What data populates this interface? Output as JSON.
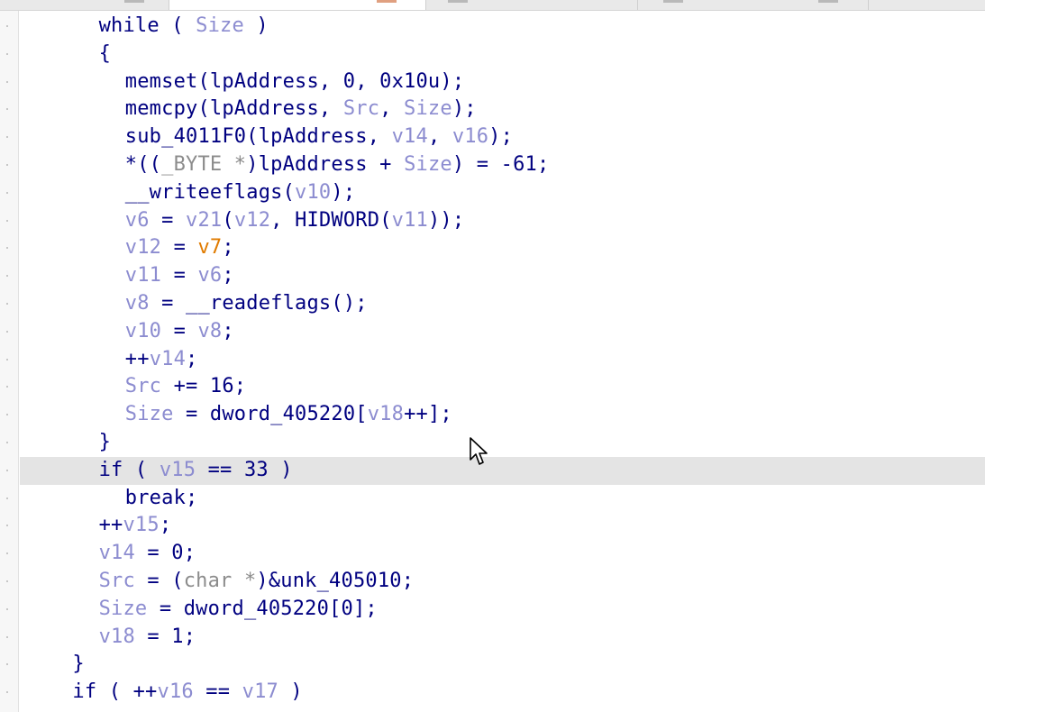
{
  "colors": {
    "keyword": "#000080",
    "variable": "#8c8cd0",
    "function": "#000080",
    "number": "#000080",
    "type": "#8c8c8c",
    "highlight_var": "#e07b00",
    "line_highlight": "#e4e4e4"
  },
  "lines": [
    {
      "indent": 3,
      "tokens": [
        [
          "while",
          "kw"
        ],
        [
          " ( ",
          "p"
        ],
        [
          "Size",
          "var"
        ],
        [
          " )",
          "p"
        ]
      ]
    },
    {
      "indent": 3,
      "tokens": [
        [
          "{",
          "p"
        ]
      ]
    },
    {
      "indent": 4,
      "tokens": [
        [
          "memset",
          "fn"
        ],
        [
          "(lpAddress, 0, 0x10u);",
          "p"
        ]
      ]
    },
    {
      "indent": 4,
      "tokens": [
        [
          "memcpy",
          "fn"
        ],
        [
          "(lpAddress, ",
          "p"
        ],
        [
          "Src",
          "var"
        ],
        [
          ", ",
          "p"
        ],
        [
          "Size",
          "var"
        ],
        [
          ");",
          "p"
        ]
      ]
    },
    {
      "indent": 4,
      "tokens": [
        [
          "sub_4011F0",
          "fn"
        ],
        [
          "(lpAddress, ",
          "p"
        ],
        [
          "v14",
          "var"
        ],
        [
          ", ",
          "p"
        ],
        [
          "v16",
          "var"
        ],
        [
          ");",
          "p"
        ]
      ]
    },
    {
      "indent": 4,
      "tokens": [
        [
          "*((",
          "p"
        ],
        [
          "_BYTE *",
          "type"
        ],
        [
          ")lpAddress + ",
          "p"
        ],
        [
          "Size",
          "var"
        ],
        [
          ") = -61;",
          "p"
        ]
      ]
    },
    {
      "indent": 4,
      "tokens": [
        [
          "__writeeflags",
          "fn"
        ],
        [
          "(",
          "p"
        ],
        [
          "v10",
          "var"
        ],
        [
          ");",
          "p"
        ]
      ]
    },
    {
      "indent": 4,
      "tokens": [
        [
          "v6",
          "var"
        ],
        [
          " = ",
          "p"
        ],
        [
          "v21",
          "var"
        ],
        [
          "(",
          "p"
        ],
        [
          "v12",
          "var"
        ],
        [
          ", ",
          "p"
        ],
        [
          "HIDWORD",
          "fn"
        ],
        [
          "(",
          "p"
        ],
        [
          "v11",
          "var"
        ],
        [
          "));",
          "p"
        ]
      ]
    },
    {
      "indent": 4,
      "tokens": [
        [
          "v12",
          "var"
        ],
        [
          " = ",
          "p"
        ],
        [
          "v7",
          "hl"
        ],
        [
          ";",
          "p"
        ]
      ]
    },
    {
      "indent": 4,
      "tokens": [
        [
          "v11",
          "var"
        ],
        [
          " = ",
          "p"
        ],
        [
          "v6",
          "var"
        ],
        [
          ";",
          "p"
        ]
      ]
    },
    {
      "indent": 4,
      "tokens": [
        [
          "v8",
          "var"
        ],
        [
          " = ",
          "p"
        ],
        [
          "__readeflags",
          "fn"
        ],
        [
          "();",
          "p"
        ]
      ]
    },
    {
      "indent": 4,
      "tokens": [
        [
          "v10",
          "var"
        ],
        [
          " = ",
          "p"
        ],
        [
          "v8",
          "var"
        ],
        [
          ";",
          "p"
        ]
      ]
    },
    {
      "indent": 4,
      "tokens": [
        [
          "++",
          "p"
        ],
        [
          "v14",
          "var"
        ],
        [
          ";",
          "p"
        ]
      ]
    },
    {
      "indent": 4,
      "tokens": [
        [
          "Src",
          "var"
        ],
        [
          " += 16;",
          "p"
        ]
      ]
    },
    {
      "indent": 4,
      "tokens": [
        [
          "Size",
          "var"
        ],
        [
          " = ",
          "p"
        ],
        [
          "dword_405220",
          "fn"
        ],
        [
          "[",
          "p"
        ],
        [
          "v18",
          "var"
        ],
        [
          "++];",
          "p"
        ]
      ]
    },
    {
      "indent": 3,
      "tokens": [
        [
          "}",
          "p"
        ]
      ]
    },
    {
      "indent": 3,
      "highlight": true,
      "tokens": [
        [
          "if",
          "kw"
        ],
        [
          " ( ",
          "p"
        ],
        [
          "v15",
          "var"
        ],
        [
          " == 33 )",
          "p"
        ]
      ]
    },
    {
      "indent": 4,
      "tokens": [
        [
          "break",
          "kw"
        ],
        [
          ";",
          "p"
        ]
      ]
    },
    {
      "indent": 3,
      "tokens": [
        [
          "++",
          "p"
        ],
        [
          "v15",
          "var"
        ],
        [
          ";",
          "p"
        ]
      ]
    },
    {
      "indent": 3,
      "tokens": [
        [
          "v14",
          "var"
        ],
        [
          " = 0;",
          "p"
        ]
      ]
    },
    {
      "indent": 3,
      "tokens": [
        [
          "Src",
          "var"
        ],
        [
          " = (",
          "p"
        ],
        [
          "char *",
          "type"
        ],
        [
          ")&unk_405010;",
          "p"
        ]
      ]
    },
    {
      "indent": 3,
      "tokens": [
        [
          "Size",
          "var"
        ],
        [
          " = ",
          "p"
        ],
        [
          "dword_405220",
          "fn"
        ],
        [
          "[0];",
          "p"
        ]
      ]
    },
    {
      "indent": 3,
      "tokens": [
        [
          "v18",
          "var"
        ],
        [
          " = 1;",
          "p"
        ]
      ]
    },
    {
      "indent": 2,
      "tokens": [
        [
          "}",
          "p"
        ]
      ]
    },
    {
      "indent": 2,
      "tokens": [
        [
          "if",
          "kw"
        ],
        [
          " ( ++",
          "p"
        ],
        [
          "v16",
          "var"
        ],
        [
          " == ",
          "p"
        ],
        [
          "v17",
          "var"
        ],
        [
          " )",
          "p"
        ]
      ]
    }
  ]
}
